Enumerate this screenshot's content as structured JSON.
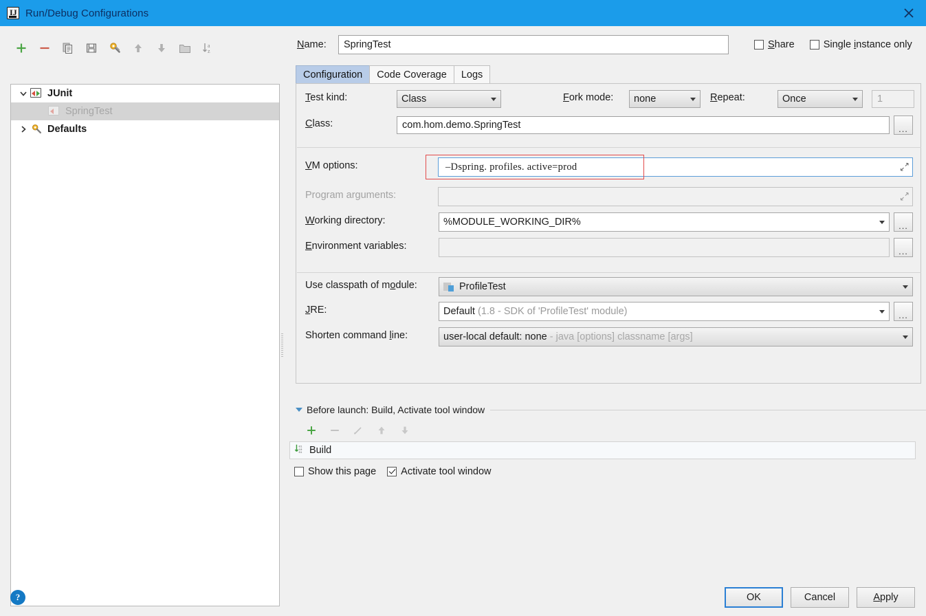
{
  "window": {
    "title": "Run/Debug Configurations",
    "icon": "intellij-idea-icon",
    "close_label": "✕"
  },
  "toolbar": {
    "buttons": [
      {
        "name": "add-configuration-button",
        "icon": "plus-icon",
        "tooltip": "Add New Configuration"
      },
      {
        "name": "remove-configuration-button",
        "icon": "minus-icon",
        "tooltip": "Remove Configuration"
      },
      {
        "name": "copy-configuration-button",
        "icon": "copy-icon",
        "tooltip": "Copy Configuration"
      },
      {
        "name": "save-configuration-button",
        "icon": "save-icon",
        "tooltip": "Save Configuration"
      },
      {
        "name": "edit-defaults-button",
        "icon": "wrench-icon",
        "tooltip": "Edit defaults"
      },
      {
        "name": "move-up-button",
        "icon": "arrow-up-icon",
        "tooltip": "Move Up"
      },
      {
        "name": "move-down-button",
        "icon": "arrow-down-icon",
        "tooltip": "Move Down"
      },
      {
        "name": "create-folder-button",
        "icon": "folder-icon",
        "tooltip": "Create New Folder"
      },
      {
        "name": "sort-button",
        "icon": "sort-az-icon",
        "tooltip": "Sort Configurations"
      }
    ]
  },
  "tree": {
    "nodes": [
      {
        "label": "JUnit",
        "icon": "junit-icon",
        "expanded": true,
        "selected": false,
        "level": 0
      },
      {
        "label": "SpringTest",
        "icon": "junit-config-icon",
        "expanded": null,
        "selected": true,
        "level": 1
      },
      {
        "label": "Defaults",
        "icon": "wrench-icon",
        "expanded": false,
        "selected": false,
        "level": 0
      }
    ]
  },
  "name_row": {
    "label": "Name:",
    "value": "SpringTest",
    "share": {
      "label": "Share",
      "checked": false
    },
    "single_instance": {
      "label": "Single instance only",
      "checked": false
    }
  },
  "tabs": [
    {
      "label": "Configuration",
      "active": true
    },
    {
      "label": "Code Coverage",
      "active": false
    },
    {
      "label": "Logs",
      "active": false
    }
  ],
  "form": {
    "test_kind": {
      "label": "Test kind:",
      "value": "Class"
    },
    "fork_mode": {
      "label": "Fork mode:",
      "value": "none"
    },
    "repeat": {
      "label": "Repeat:",
      "value": "Once",
      "count": "1"
    },
    "class": {
      "label": "Class:",
      "value": "com.hom.demo.SpringTest",
      "browse": "..."
    },
    "vm_options": {
      "label": "VM options:",
      "value": "–Dspring. profiles. active=prod",
      "expand_icon": "expand-diagonal-icon",
      "highlight_color": "#e24b4b"
    },
    "program_arguments": {
      "label": "Program arguments:",
      "value": "",
      "expand_icon": "expand-diagonal-icon"
    },
    "working_directory": {
      "label": "Working directory:",
      "value": "%MODULE_WORKING_DIR%",
      "browse": "..."
    },
    "environment_variables": {
      "label": "Environment variables:",
      "value": "",
      "browse": "..."
    },
    "use_classpath_of_module": {
      "label": "Use classpath of module:",
      "value": "ProfileTest",
      "icon": "module-icon"
    },
    "jre": {
      "label": "JRE:",
      "value": "Default",
      "hint": "(1.8 - SDK of 'ProfileTest' module)",
      "browse": "..."
    },
    "shorten_command_line": {
      "label": "Shorten command line:",
      "value": "user-local default: none",
      "hint": "- java [options] classname [args]"
    }
  },
  "before_launch": {
    "title": "Before launch: Build, Activate tool window",
    "toolbar": [
      {
        "name": "before-launch-add-button",
        "icon": "plus-icon"
      },
      {
        "name": "before-launch-remove-button",
        "icon": "minus-icon"
      },
      {
        "name": "before-launch-edit-button",
        "icon": "pencil-icon"
      },
      {
        "name": "before-launch-move-up-button",
        "icon": "arrow-up-icon"
      },
      {
        "name": "before-launch-move-down-button",
        "icon": "arrow-down-icon"
      }
    ],
    "items": [
      {
        "label": "Build",
        "icon": "build-icon"
      }
    ],
    "show_this_page": {
      "label": "Show this page",
      "checked": false
    },
    "activate_tool_window": {
      "label": "Activate tool window",
      "checked": true
    }
  },
  "footer": {
    "help": "?",
    "ok": "OK",
    "cancel": "Cancel",
    "apply": "Apply"
  },
  "colors": {
    "titlebar": "#1b9cea",
    "accent": "#2a7fd4",
    "active_tab": "#b8cce8",
    "annotation": "#e24b4b",
    "add_green": "#4aa544",
    "remove_red": "#cc5b4a"
  }
}
